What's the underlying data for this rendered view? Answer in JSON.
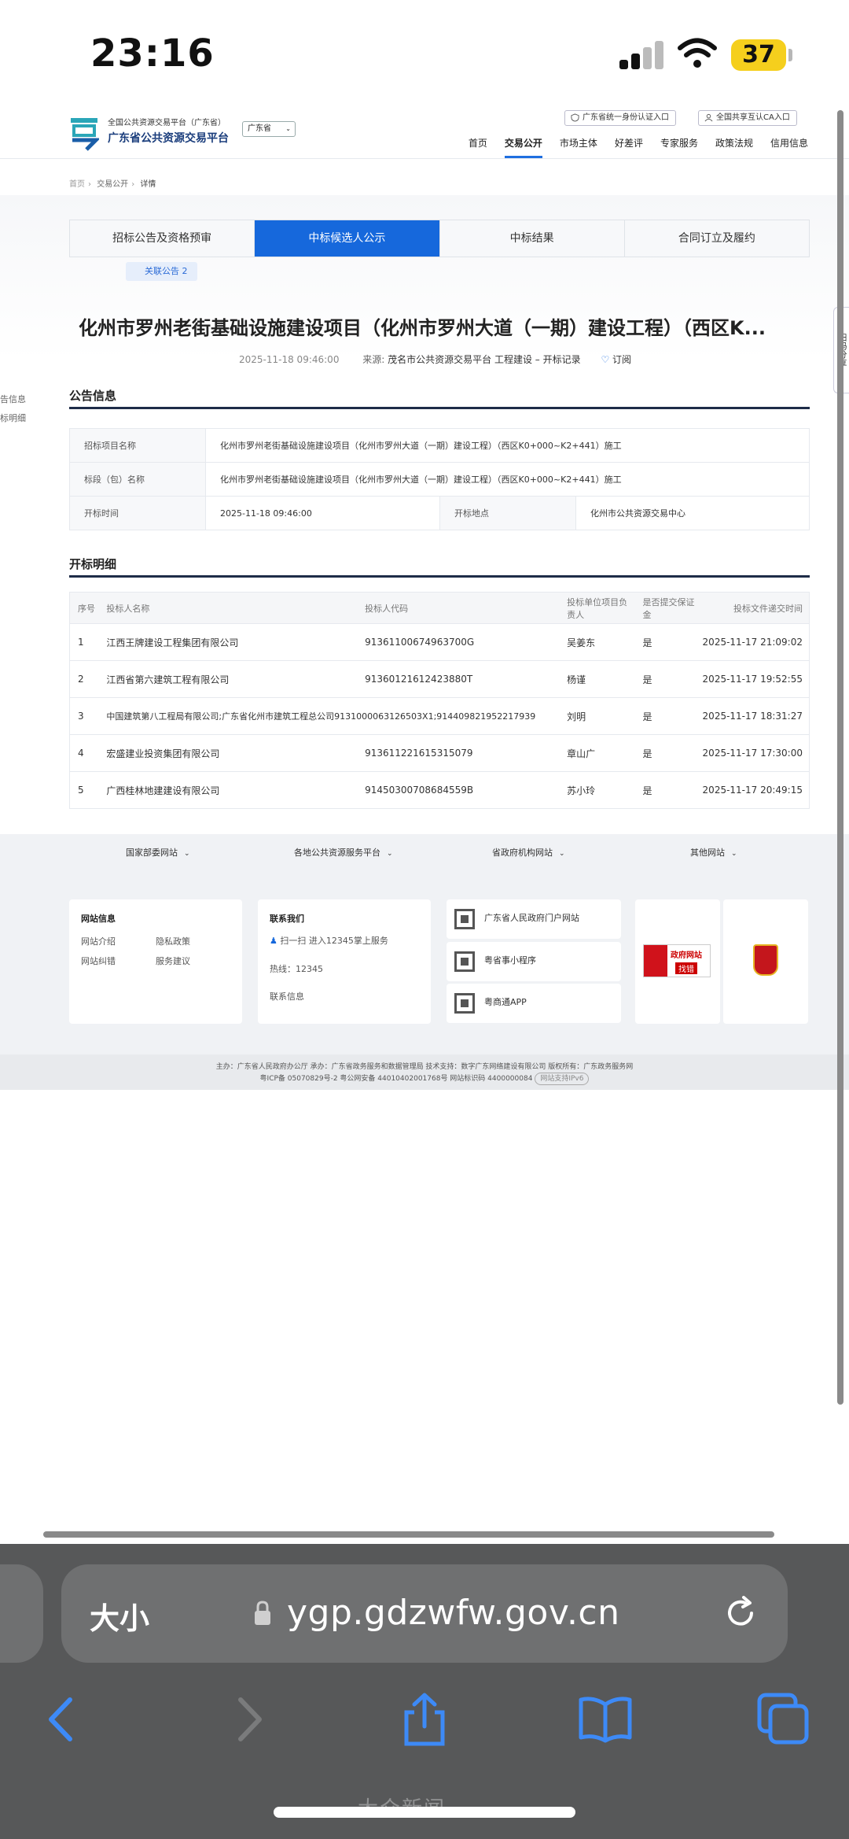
{
  "status": {
    "time": "23:16",
    "battery": "37"
  },
  "site": {
    "logo_line1": "全国公共资源交易平台（广东省）",
    "logo_line2": "广东省公共资源交易平台",
    "region": "广东省",
    "top_link_1": "广东省统一身份认证入口",
    "top_link_2": "全国共享互认CA入口",
    "nav": [
      "首页",
      "交易公开",
      "市场主体",
      "好差评",
      "专家服务",
      "政策法规",
      "信用信息"
    ]
  },
  "breadcrumb": [
    "首页",
    "交易公开",
    "详情"
  ],
  "tabs": [
    "招标公告及资格预审",
    "中标候选人公示",
    "中标结果",
    "合同订立及履约"
  ],
  "related": "关联公告 2",
  "notice": {
    "title": "化州市罗州老街基础设施建设项目（化州市罗州大道（一期）建设工程）（西区K...",
    "date": "2025-11-18 09:46:00",
    "source_label": "来源:",
    "source": "茂名市公共资源交易平台 工程建设 – 开标记录",
    "subscribe": "订阅"
  },
  "side_menu": [
    "告信息",
    "标明细"
  ],
  "side_qr": "扫码分享",
  "info_section": {
    "heading": "公告信息",
    "rows": [
      {
        "k": "招标项目名称",
        "v": "化州市罗州老街基础设施建设项目（化州市罗州大道（一期）建设工程）（西区K0+000~K2+441）施工"
      },
      {
        "k": "标段（包）名称",
        "v": "化州市罗州老街基础设施建设项目（化州市罗州大道（一期）建设工程）（西区K0+000~K2+441）施工"
      }
    ],
    "open_time_k": "开标时间",
    "open_time_v": "2025-11-18 09:46:00",
    "open_place_k": "开标地点",
    "open_place_v": "化州市公共资源交易中心"
  },
  "detail_section": {
    "heading": "开标明细",
    "headers": [
      "序号",
      "投标人名称",
      "投标人代码",
      "投标单位项目负责人",
      "是否提交保证金",
      "投标文件递交时间"
    ],
    "rows": [
      {
        "no": "1",
        "name": "江西王牌建设工程集团有限公司",
        "code": "91361100674963700G",
        "pm": "吴姜东",
        "deposit": "是",
        "time": "2025-11-17 21:09:02"
      },
      {
        "no": "2",
        "name": "江西省第六建筑工程有限公司",
        "code": "91360121612423880T",
        "pm": "杨谨",
        "deposit": "是",
        "time": "2025-11-17 19:52:55"
      },
      {
        "no": "3",
        "name": "中国建筑第八工程局有限公司;广东省化州市建筑工程总公司",
        "code": "9131000063126503X1;914409821952217939",
        "pm": "刘明",
        "deposit": "是",
        "time": "2025-11-17 18:31:27"
      },
      {
        "no": "4",
        "name": "宏盛建业投资集团有限公司",
        "code": "913611221615315079",
        "pm": "章山广",
        "deposit": "是",
        "time": "2025-11-17 17:30:00"
      },
      {
        "no": "5",
        "name": "广西桂林地建建设有限公司",
        "code": "91450300708684559B",
        "pm": "苏小玲",
        "deposit": "是",
        "time": "2025-11-17 20:49:15"
      }
    ]
  },
  "footer": {
    "links": [
      "国家部委网站",
      "各地公共资源服务平台",
      "省政府机构网站",
      "其他网站"
    ],
    "site_info_title": "网站信息",
    "site_info": [
      "网站介绍",
      "隐私政策",
      "网站纠错",
      "服务建议"
    ],
    "contact_title": "联系我们",
    "contact_scan": "扫一扫 进入12345掌上服务",
    "hotline": "热线：12345",
    "contact_info": "联系信息",
    "qr_items": [
      "广东省人民政府门户网站",
      "粤省事小程序",
      "粤商通APP"
    ],
    "gov_badge_1": "政府网站",
    "gov_badge_2": "找错",
    "copyright_1": "主办：广东省人民政府办公厅 承办：广东省政务服务和数据管理局 技术支持：数字广东网络建设有限公司 版权所有：广东政务服务网",
    "copyright_2": "粤ICP备 05070829号-2   粤公网安备 44010402001768号 网站标识码 4400000084",
    "ipv6": "网站支持IPv6"
  },
  "browser": {
    "size_label": "大小",
    "url": "ygp.gdzwfw.gov.cn"
  },
  "watermark": "大众新闻"
}
